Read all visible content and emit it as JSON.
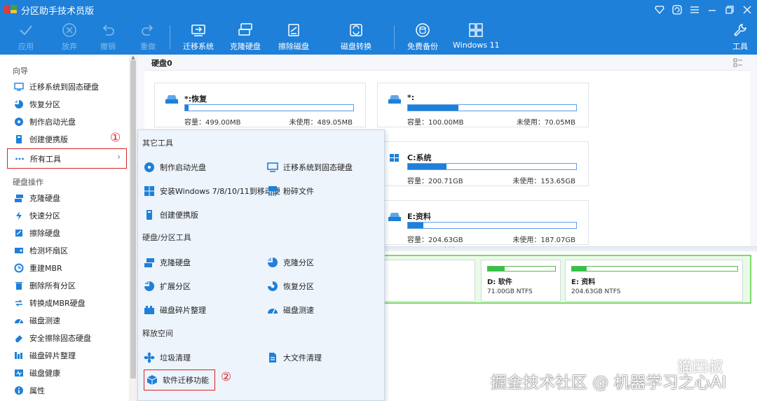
{
  "window": {
    "title": "分区助手技术员版"
  },
  "toolbar": {
    "apply": "应用",
    "discard": "放弃",
    "undo": "撤销",
    "redo": "重做",
    "migrate_os": "迁移系统",
    "clone_disk": "克隆硬盘",
    "wipe_disk": "擦除磁盘",
    "convert_disk": "磁盘转换",
    "free_backup": "免费备份",
    "windows11": "Windows 11",
    "tools": "工具"
  },
  "sidebar": {
    "section_wizard": "向导",
    "wizard_items": [
      "迁移系统到固态硬盘",
      "恢复分区",
      "制作启动光盘",
      "创建便携版",
      "所有工具"
    ],
    "section_disk_ops": "硬盘操作",
    "disk_items": [
      "克隆硬盘",
      "快速分区",
      "擦除硬盘",
      "检测坏扇区",
      "重建MBR",
      "删除所有分区",
      "转换成MBR硬盘",
      "磁盘测速",
      "安全擦除固态硬盘",
      "磁盘碎片整理",
      "磁盘健康",
      "属性"
    ]
  },
  "annotations": {
    "step1": "①",
    "step2": "②"
  },
  "main": {
    "disk_header": "硬盘0",
    "partitions": [
      {
        "name": "*:恢复",
        "capacity": "容量：499.00MB",
        "free": "未使用：489.05MB",
        "used_fraction": 0.02
      },
      {
        "name": "*:",
        "capacity": "容量：100.00MB",
        "free": "未使用：70.05MB",
        "used_fraction": 0.3
      },
      {
        "name": "C:系统",
        "capacity": "容量：200.71GB",
        "free": "未使用：153.65GB",
        "used_fraction": 0.23
      },
      {
        "name": "E:资料",
        "capacity": "容量：204.63GB",
        "free": "未使用：187.07GB",
        "used_fraction": 0.09
      }
    ],
    "disk_map": [
      {
        "name": "D: 软件",
        "info": "71.00GB NTFS",
        "used_fraction": 0.25
      },
      {
        "name": "E: 资料",
        "info": "204.63GB NTFS",
        "used_fraction": 0.09
      }
    ]
  },
  "popup": {
    "section_other": "其它工具",
    "other_items": [
      "制作启动光盘",
      "迁移系统到固态硬盘",
      "安装Windows 7/8/10/11到移动硬",
      "粉碎文件",
      "创建便携版"
    ],
    "section_disk_tools": "硬盘/分区工具",
    "disk_tool_items": [
      "克隆硬盘",
      "克隆分区",
      "扩展分区",
      "恢复分区",
      "磁盘碎片整理",
      "磁盘测速"
    ],
    "section_free_space": "释放空间",
    "free_items": [
      "垃圾清理",
      "大文件清理",
      "软件迁移功能"
    ]
  },
  "watermark": {
    "text": "掘金技术社区 @ 机器学习之心AI",
    "author": "猫四叔"
  },
  "colors": {
    "titlebar": "#1e80d9",
    "accent": "#1e80d9",
    "highlight": "#d6232a",
    "green": "#33c24a"
  }
}
